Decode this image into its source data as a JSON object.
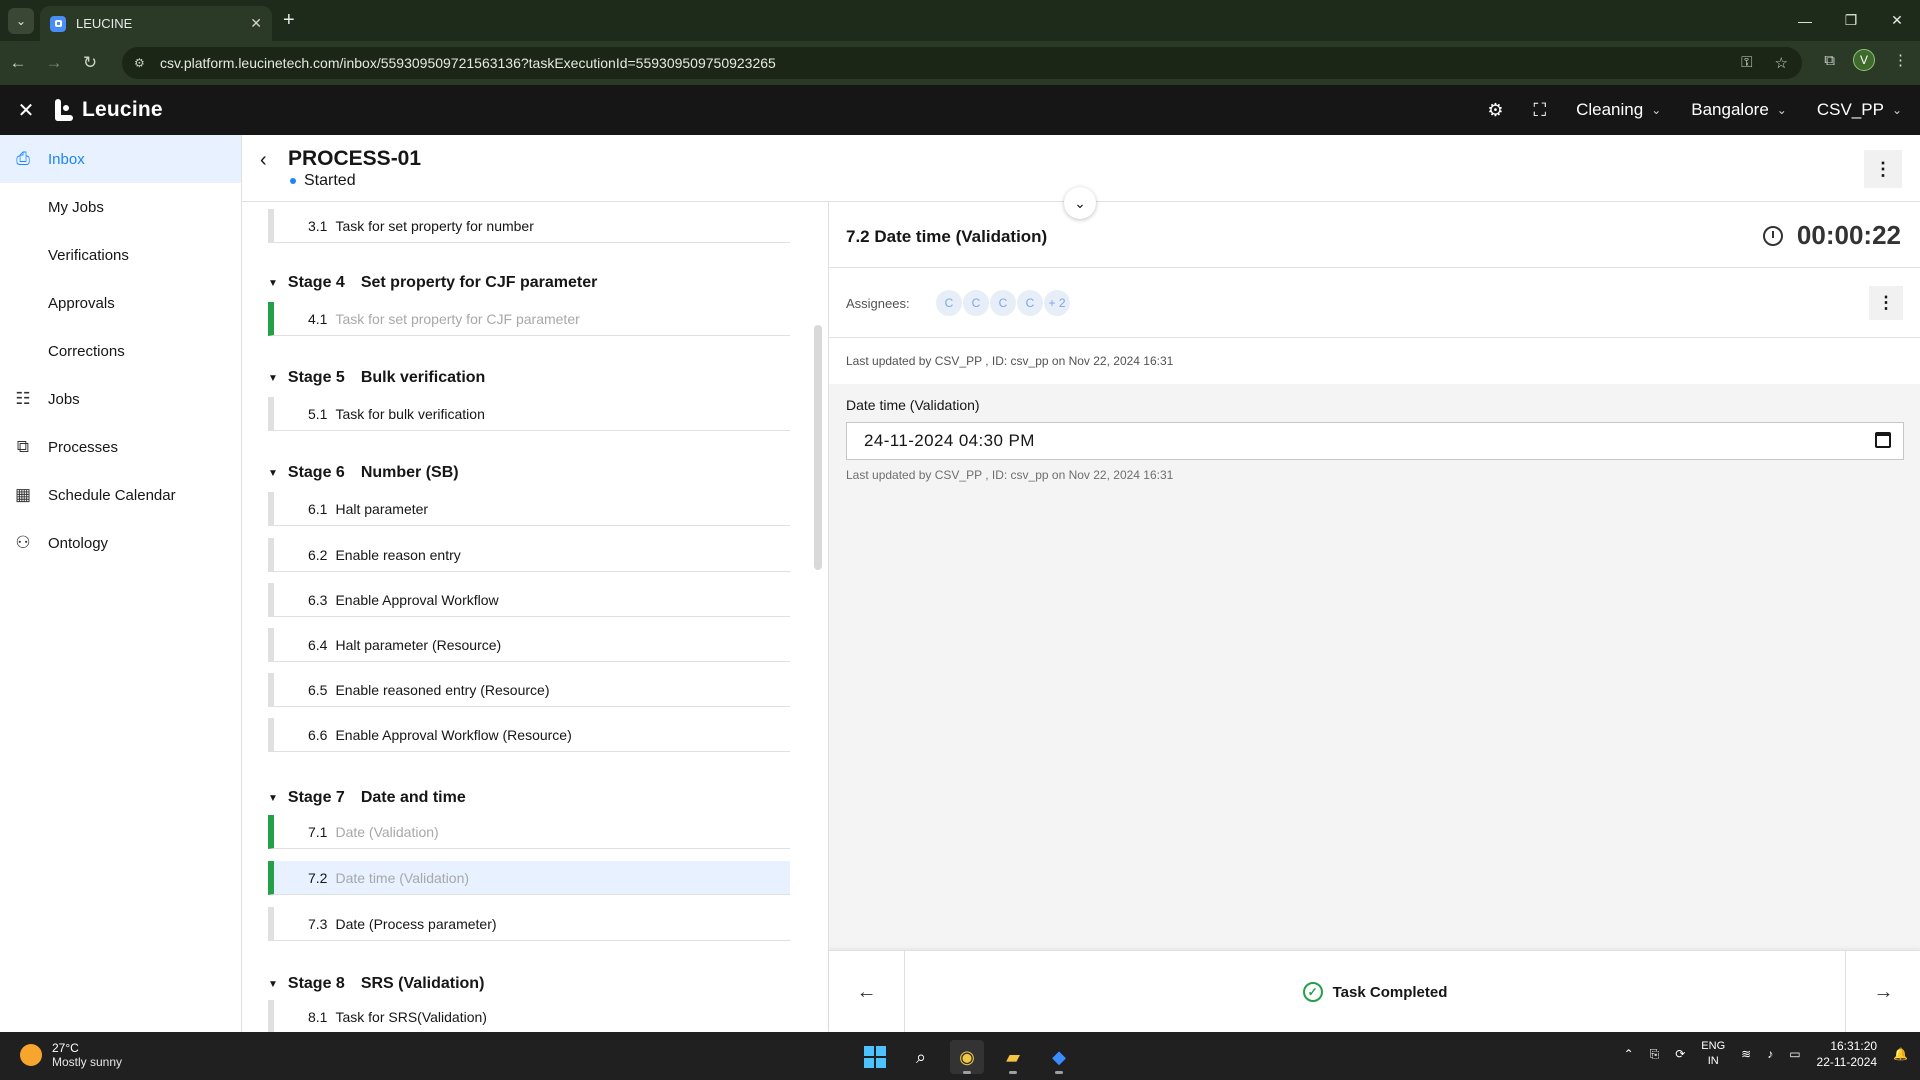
{
  "browser": {
    "tab_title": "LEUCINE",
    "url": "csv.platform.leucinetech.com/inbox/559309509721563136?taskExecutionId=559309509750923265",
    "profile_initial": "V"
  },
  "header": {
    "brand": "Leucine",
    "dropdowns": [
      "Cleaning",
      "Bangalore",
      "CSV_PP"
    ]
  },
  "sidebar": {
    "items": [
      {
        "label": "Inbox",
        "icon": "inbox-icon",
        "active": true
      },
      {
        "label": "My Jobs"
      },
      {
        "label": "Verifications"
      },
      {
        "label": "Approvals"
      },
      {
        "label": "Corrections"
      },
      {
        "label": "Jobs",
        "icon": "clipboard-icon"
      },
      {
        "label": "Processes",
        "icon": "processes-icon"
      },
      {
        "label": "Schedule Calendar",
        "icon": "calendar-icon"
      },
      {
        "label": "Ontology",
        "icon": "hierarchy-icon"
      }
    ]
  },
  "process": {
    "title": "PROCESS-01",
    "status": "Started"
  },
  "stages": {
    "top_task": {
      "num": "3.1",
      "label": "Task for set property for number"
    },
    "s4": {
      "num": "Stage 4",
      "name": "Set property for CJF parameter",
      "tasks": [
        {
          "num": "4.1",
          "label": "Task for set property for CJF parameter"
        }
      ]
    },
    "s5": {
      "num": "Stage 5",
      "name": "Bulk verification",
      "tasks": [
        {
          "num": "5.1",
          "label": "Task for bulk verification"
        }
      ]
    },
    "s6": {
      "num": "Stage 6",
      "name": "Number (SB)",
      "tasks": [
        {
          "num": "6.1",
          "label": "Halt parameter"
        },
        {
          "num": "6.2",
          "label": "Enable reason entry"
        },
        {
          "num": "6.3",
          "label": "Enable Approval Workflow"
        },
        {
          "num": "6.4",
          "label": "Halt parameter (Resource)"
        },
        {
          "num": "6.5",
          "label": "Enable reasoned entry (Resource)"
        },
        {
          "num": "6.6",
          "label": "Enable Approval Workflow (Resource)"
        }
      ]
    },
    "s7": {
      "num": "Stage 7",
      "name": "Date and time",
      "tasks": [
        {
          "num": "7.1",
          "label": "Date (Validation)"
        },
        {
          "num": "7.2",
          "label": "Date time (Validation)"
        },
        {
          "num": "7.3",
          "label": "Date (Process parameter)"
        }
      ]
    },
    "s8": {
      "num": "Stage 8",
      "name": "SRS (Validation)",
      "tasks": [
        {
          "num": "8.1",
          "label": "Task for SRS(Validation)"
        }
      ]
    }
  },
  "task": {
    "title": "7.2 Date time (Validation)",
    "timer": "00:00:22",
    "assignees_label": "Assignees:",
    "assignees": [
      "C",
      "C",
      "C",
      "C",
      "+ 2"
    ],
    "last_updated": "Last updated by CSV_PP , ID: csv_pp on Nov 22, 2024 16:31",
    "field_label": "Date time (Validation)",
    "field_value": "24-11-2024 04:30 PM",
    "field_updated": "Last updated by CSV_PP , ID: csv_pp on Nov 22, 2024 16:31",
    "footer_status": "Task Completed"
  },
  "taskbar": {
    "temp": "27°C",
    "weather": "Mostly sunny",
    "lang1": "ENG",
    "lang2": "IN",
    "time": "16:31:20",
    "date": "22-11-2024"
  },
  "colors": {
    "accent": "#1d84ff",
    "done": "#24a148",
    "header_bg": "#161616"
  }
}
